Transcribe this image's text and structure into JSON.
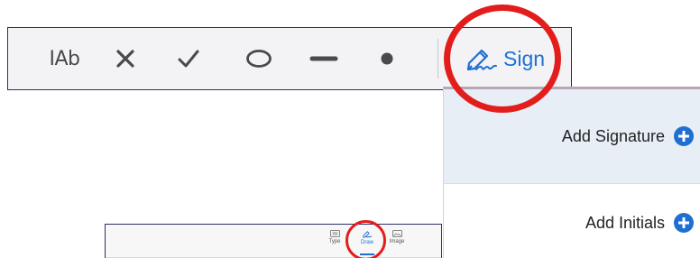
{
  "toolbar": {
    "tools": [
      {
        "name": "text-tool",
        "label": "IAb",
        "icon": "text-cursor-icon"
      },
      {
        "name": "cross-tool",
        "icon": "cross-icon"
      },
      {
        "name": "check-tool",
        "icon": "checkmark-icon"
      },
      {
        "name": "oval-tool",
        "icon": "oval-icon"
      },
      {
        "name": "line-tool",
        "icon": "line-icon"
      },
      {
        "name": "dot-tool",
        "icon": "dot-icon"
      }
    ],
    "sign_label": "Sign",
    "sign_icon": "pen-signature-icon"
  },
  "sign_menu": {
    "items": [
      {
        "label": "Add Signature",
        "icon": "plus-circle-icon"
      },
      {
        "label": "Add Initials",
        "icon": "plus-circle-icon"
      }
    ]
  },
  "inset": {
    "tabs": [
      {
        "label": "Type",
        "icon": "keyboard-icon"
      },
      {
        "label": "Draw",
        "icon": "pen-signature-icon",
        "active": true
      },
      {
        "label": "Image",
        "icon": "image-icon"
      }
    ]
  },
  "colors": {
    "accent": "#1f6fd1",
    "highlight": "#e31c1c",
    "toolbar_bg": "#f3f3f5",
    "selected_item_bg": "#e7eef6"
  }
}
